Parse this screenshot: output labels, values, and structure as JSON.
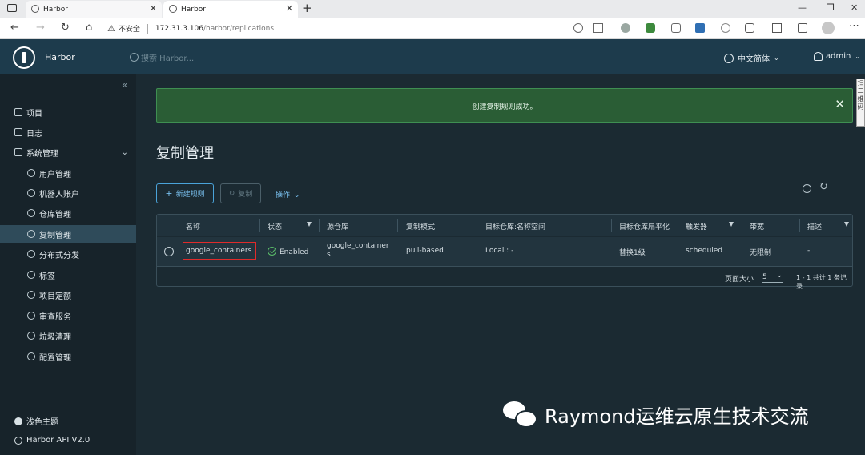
{
  "browser": {
    "tabs": [
      {
        "label": "Harbor"
      },
      {
        "label": "Harbor"
      }
    ],
    "security_label": "不安全",
    "url_host": "172.31.3.106",
    "url_path": "/harbor/replications"
  },
  "header": {
    "brand": "Harbor",
    "search_placeholder": "搜索 Harbor...",
    "language": "中文简体",
    "user": "admin"
  },
  "sidebar": {
    "items": [
      {
        "label": "项目"
      },
      {
        "label": "日志"
      },
      {
        "label": "系统管理"
      }
    ],
    "sub_items": [
      {
        "label": "用户管理"
      },
      {
        "label": "机器人账户"
      },
      {
        "label": "仓库管理"
      },
      {
        "label": "复制管理"
      },
      {
        "label": "分布式分发"
      },
      {
        "label": "标签"
      },
      {
        "label": "项目定额"
      },
      {
        "label": "审查服务"
      },
      {
        "label": "垃圾清理"
      },
      {
        "label": "配置管理"
      }
    ],
    "theme_label": "浅色主题",
    "api_label": "Harbor API V2.0"
  },
  "alert": {
    "message": "创建复制规则成功。"
  },
  "side_note": "扫\n二\n维\n码",
  "main": {
    "title": "复制管理",
    "new_rule_label": "新建规则",
    "copy_label": "复制",
    "actions_label": "操作"
  },
  "table": {
    "columns": [
      "名称",
      "状态",
      "源仓库",
      "复制模式",
      "目标仓库:名称空间",
      "目标仓库扁平化",
      "触发器",
      "带宽",
      "描述"
    ],
    "rows": [
      {
        "name": "google_containers",
        "status": "Enabled",
        "source_line1": "google_container",
        "source_line2": "s",
        "mode": "pull-based",
        "dest": "Local : -",
        "flatten": "替换1级",
        "trigger": "scheduled",
        "bandwidth": "无限制",
        "description": "-"
      }
    ],
    "page_size_label": "页面大小",
    "page_size": "5",
    "summary": "1 - 1 共计 1 条记录"
  },
  "watermark": {
    "text": "Raymond运维云原生技术交流"
  },
  "colors": {
    "header": "#1d3b4c",
    "sidebar": "#17232a",
    "main": "#1b2a32",
    "alert": "#2a5d35",
    "accent": "#79c0ef"
  }
}
